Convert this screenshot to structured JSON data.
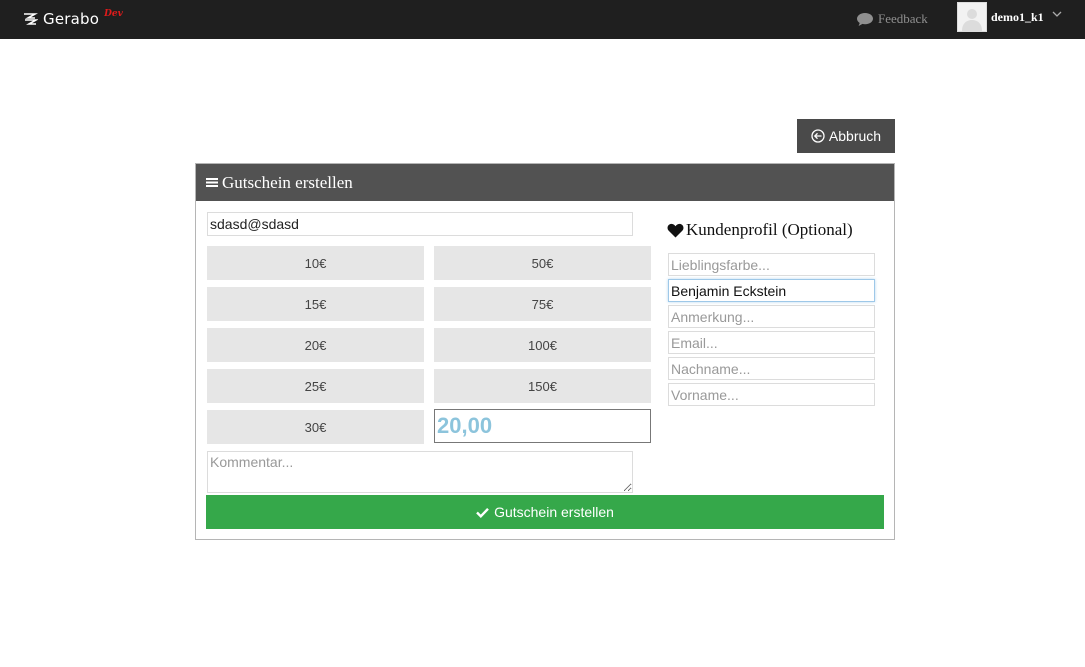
{
  "navbar": {
    "brand_name": "Gerabo",
    "brand_tag": "Dev",
    "feedback_label": "Feedback",
    "username": "demo1_k1"
  },
  "cancel_label": "Abbruch",
  "panel": {
    "title": "Gutschein erstellen",
    "email_value": "sdasd@sdasd",
    "amounts": [
      "10€",
      "50€",
      "15€",
      "75€",
      "20€",
      "100€",
      "25€",
      "150€",
      "30€"
    ],
    "custom_amount_value": "20,00",
    "comment_placeholder": "Kommentar...",
    "submit_label": "Gutschein erstellen"
  },
  "profile": {
    "title": "Kundenprofil (Optional)",
    "fields": [
      {
        "placeholder": "Lieblingsfarbe...",
        "value": ""
      },
      {
        "placeholder": "",
        "value": "Benjamin Eckstein"
      },
      {
        "placeholder": "Anmerkung...",
        "value": ""
      },
      {
        "placeholder": "Email...",
        "value": ""
      },
      {
        "placeholder": "Nachname...",
        "value": ""
      },
      {
        "placeholder": "Vorname...",
        "value": ""
      }
    ]
  },
  "colors": {
    "navbar_bg": "#1f1f1f",
    "panel_header_bg": "#525252",
    "submit_green": "#35a84a",
    "amount_text_blue": "#8cc4dc",
    "brand_tag_red": "#e01b1b"
  },
  "icons": {
    "brand": "gerabo-logo-icon",
    "feedback": "speech-bubble-icon",
    "user_menu": "chevron-down-icon",
    "cancel": "arrow-circle-left-icon",
    "panel": "menu-bars-icon",
    "profile": "heart-icon",
    "submit": "checkmark-icon"
  }
}
